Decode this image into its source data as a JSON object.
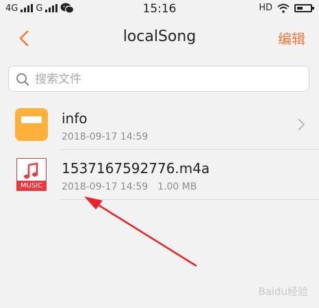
{
  "status_bar": {
    "sim1": "4G",
    "sim2": "G",
    "time": "15:16",
    "network": "HD"
  },
  "header": {
    "title": "localSong",
    "edit_label": "编辑"
  },
  "search": {
    "placeholder": "搜索文件"
  },
  "files": [
    {
      "name": "info",
      "type": "folder",
      "date": "2018-09-17 14:59"
    },
    {
      "name": "1537167592776.m4a",
      "type": "music",
      "date": "2018-09-17 14:59",
      "size": "1.00 MB",
      "badge": "MUSIC"
    }
  ],
  "colors": {
    "accent": "#f07838",
    "folder": "#fdb03c",
    "music": "#e8383d"
  },
  "watermark": "Baidu经验"
}
